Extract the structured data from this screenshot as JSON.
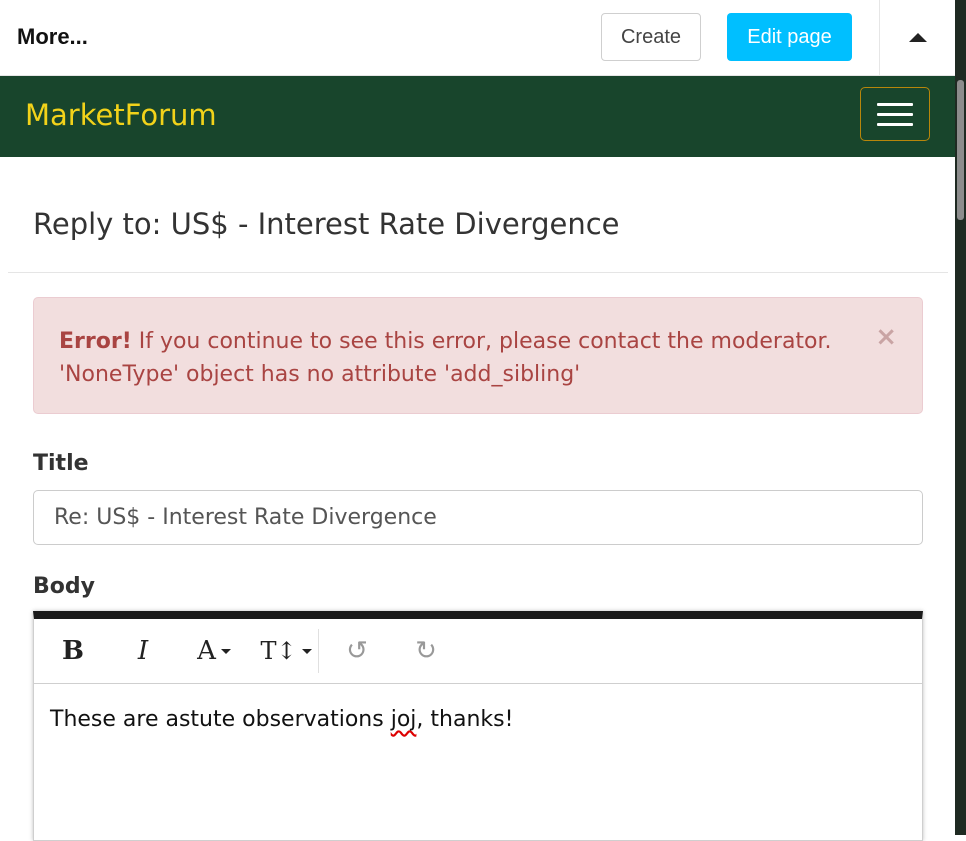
{
  "admin_bar": {
    "more_label": "More...",
    "create_label": "Create",
    "edit_label": "Edit page"
  },
  "navbar": {
    "brand": "MarketForum"
  },
  "page": {
    "title": "Reply to: US$ - Interest Rate Divergence"
  },
  "alert": {
    "heading": "Error!",
    "message": " If you continue to see this error, please contact the moderator.",
    "detail": "'NoneType' object has no attribute 'add_sibling'",
    "close_glyph": "×"
  },
  "form": {
    "title_label": "Title",
    "title_value": "Re: US$ - Interest Rate Divergence",
    "body_label": "Body",
    "body_text_before": "These are astute observations ",
    "body_misspelled": "joj",
    "body_text_after": ", thanks!"
  },
  "editor_toolbar": {
    "bold": "B",
    "italic": "I",
    "font": "A",
    "size": "T↕",
    "undo": "↺",
    "redo": "↻"
  },
  "colors": {
    "navbar_bg": "#18452c",
    "brand": "#f2d21a",
    "edit_button": "#00bfff",
    "alert_bg": "#f2dede",
    "alert_text": "#a94442"
  }
}
